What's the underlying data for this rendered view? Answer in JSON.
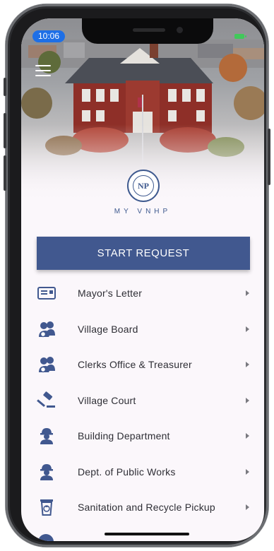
{
  "status_bar": {
    "time": "10:06"
  },
  "hero": {
    "photo": "village-hall-aerial-photo"
  },
  "brand": {
    "name": "MY VNHP",
    "seal_monogram": "NP"
  },
  "start_request": {
    "label": "START REQUEST"
  },
  "menu": {
    "items": [
      {
        "label": "Mayor's Letter",
        "icon": "letter-icon"
      },
      {
        "label": "Village Board",
        "icon": "people-group-icon"
      },
      {
        "label": "Clerks Office & Treasurer",
        "icon": "people-group-icon"
      },
      {
        "label": "Village Court",
        "icon": "gavel-icon"
      },
      {
        "label": "Building Department",
        "icon": "hard-hat-worker-icon"
      },
      {
        "label": "Dept. of Public Works",
        "icon": "hard-hat-worker-icon"
      },
      {
        "label": "Sanitation and Recycle Pickup",
        "icon": "recycle-bin-icon"
      }
    ]
  },
  "colors": {
    "accent": "#41588f",
    "time_pill": "#1e6fe6",
    "background": "#fbf7fb"
  }
}
